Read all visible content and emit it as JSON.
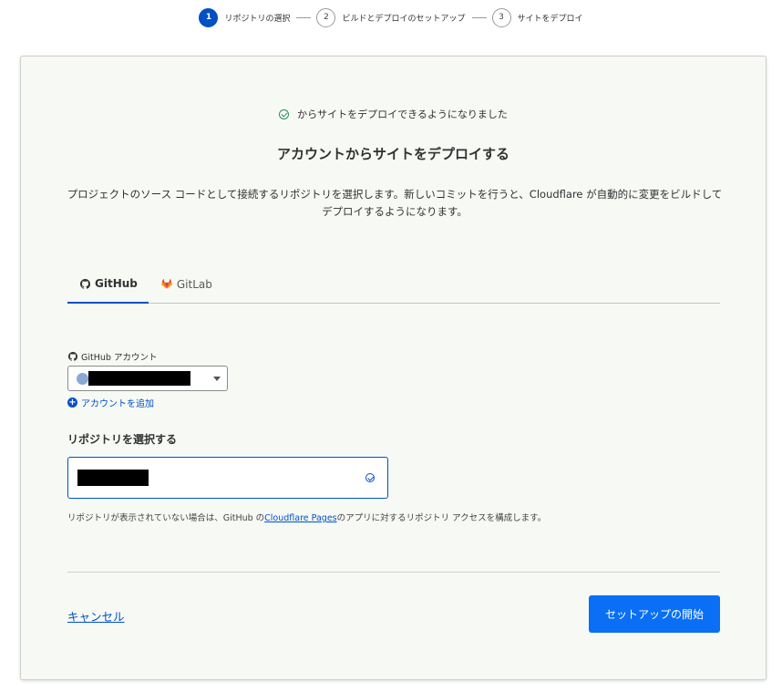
{
  "stepper": {
    "steps": [
      {
        "number": "1",
        "label": "リポジトリの選択",
        "active": true
      },
      {
        "number": "2",
        "label": "ビルドとデプロイのセットアップ",
        "active": false
      },
      {
        "number": "3",
        "label": "サイトをデプロイ",
        "active": false
      }
    ]
  },
  "card": {
    "banner": "からサイトをデプロイできるようになりました",
    "heading": "アカウントからサイトをデプロイする",
    "description": "プロジェクトのソース コードとして接続するリポジトリを選択します。新しいコミットを行うと、Cloudflare が自動的に変更をビルドしてデプロイするようになります。",
    "tabs": [
      {
        "label": "GitHub",
        "icon": "github-icon",
        "active": true
      },
      {
        "label": "GitLab",
        "icon": "gitlab-icon",
        "active": false
      }
    ],
    "account_label": "GitHub アカウント",
    "add_account": "アカウントを追加",
    "repo_heading": "リポジトリを選択する",
    "note_before": "リポジトリが表示されていない場合は、GitHub の",
    "note_link": "Cloudflare Pages",
    "note_after": "のアプリに対するリポジトリ アクセスを構成します。",
    "cancel_label": "キャンセル",
    "primary_label": "セットアップの開始"
  },
  "colors": {
    "accent": "#0051c3",
    "primary_button": "#0a6ff5",
    "success": "#2e8a57",
    "card_background": "#f7f9f5"
  }
}
